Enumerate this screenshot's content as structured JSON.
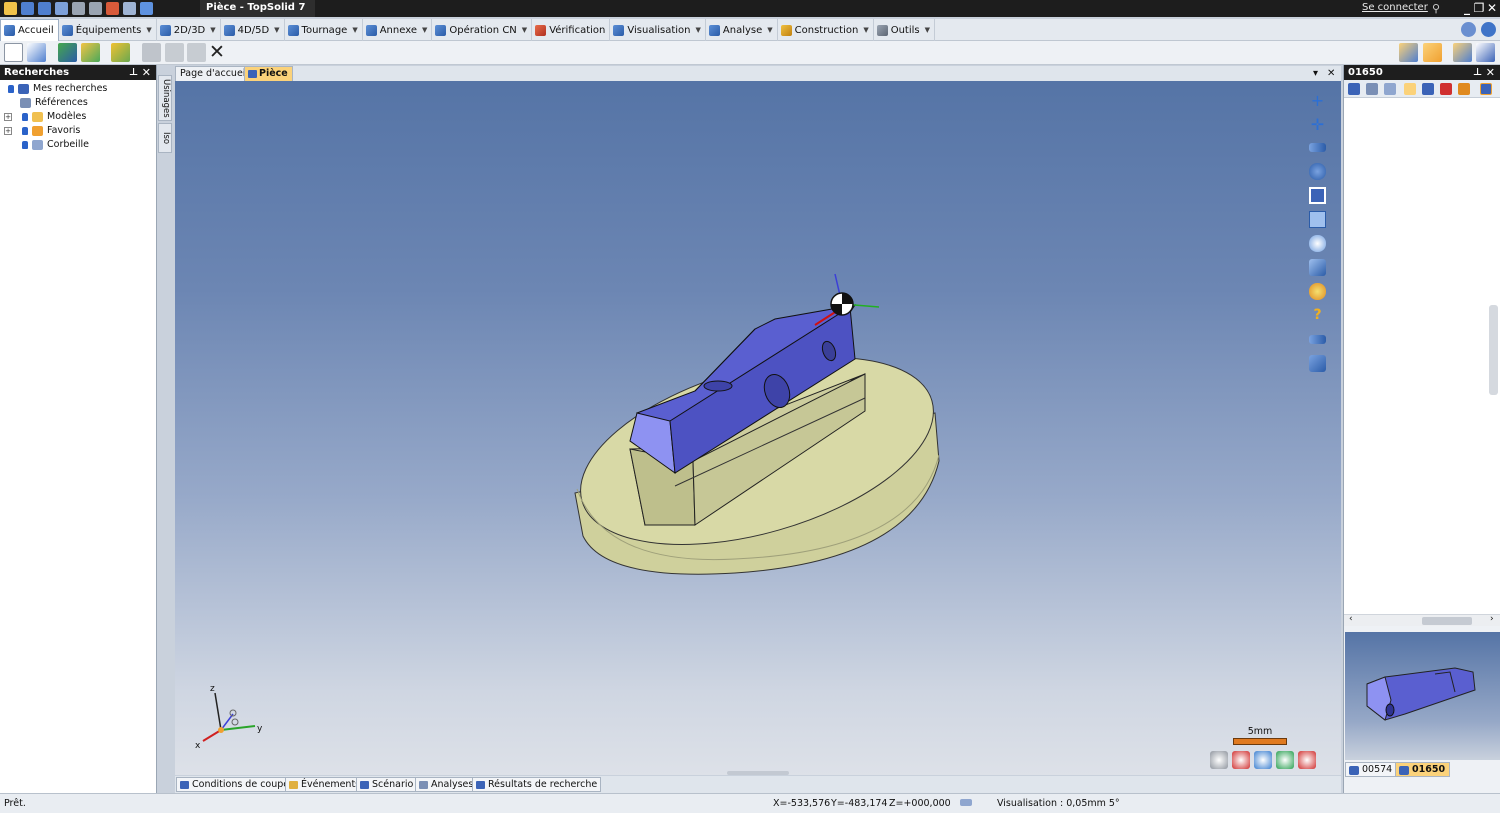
{
  "window": {
    "title": "Pièce - TopSolid 7",
    "sign_in": "Se connecter"
  },
  "menu": {
    "items": [
      {
        "label": "Accueil",
        "active": true
      },
      {
        "label": "Équipements"
      },
      {
        "label": "2D/3D"
      },
      {
        "label": "4D/5D"
      },
      {
        "label": "Tournage"
      },
      {
        "label": "Annexe"
      },
      {
        "label": "Opération CN"
      },
      {
        "label": "Vérification"
      },
      {
        "label": "Visualisation"
      },
      {
        "label": "Analyse"
      },
      {
        "label": "Construction"
      },
      {
        "label": "Outils"
      }
    ]
  },
  "left_panel": {
    "title": "Recherches",
    "tree": [
      {
        "label": "Mes recherches",
        "icon": "search-folder-icon"
      },
      {
        "label": "Références",
        "icon": "references-icon"
      },
      {
        "label": "Modèles",
        "icon": "models-folder-icon"
      },
      {
        "label": "Favoris",
        "icon": "favorites-folder-icon"
      },
      {
        "label": "Corbeille",
        "icon": "recycle-bin-icon"
      }
    ]
  },
  "vertical_tabs": [
    "Usinages",
    "Iso"
  ],
  "document_tabs": [
    {
      "label": "Page d'accueil"
    },
    {
      "label": "Pièce",
      "active": true
    }
  ],
  "viewport": {
    "scale_label": "5mm",
    "axes": {
      "x": "x",
      "y": "y",
      "z": "z"
    }
  },
  "bottom_tabs": [
    "Conditions de coupe",
    "Événements",
    "Scénario",
    "Analyses",
    "Résultats de recherche"
  ],
  "right_panel": {
    "title": "01650",
    "preview_tabs": [
      {
        "label": "00574"
      },
      {
        "label": "01650",
        "active": true
      }
    ]
  },
  "status": {
    "ready": "Prêt.",
    "x": "X=-533,576",
    "y": "Y=-483,174",
    "z": "Z=+000,000",
    "visualisation": "Visualisation : 0,05mm 5°"
  },
  "colors": {
    "accent": "#fbd27a",
    "part_blue": "#5a5fd0",
    "fixture_green": "#d8d9a6"
  }
}
